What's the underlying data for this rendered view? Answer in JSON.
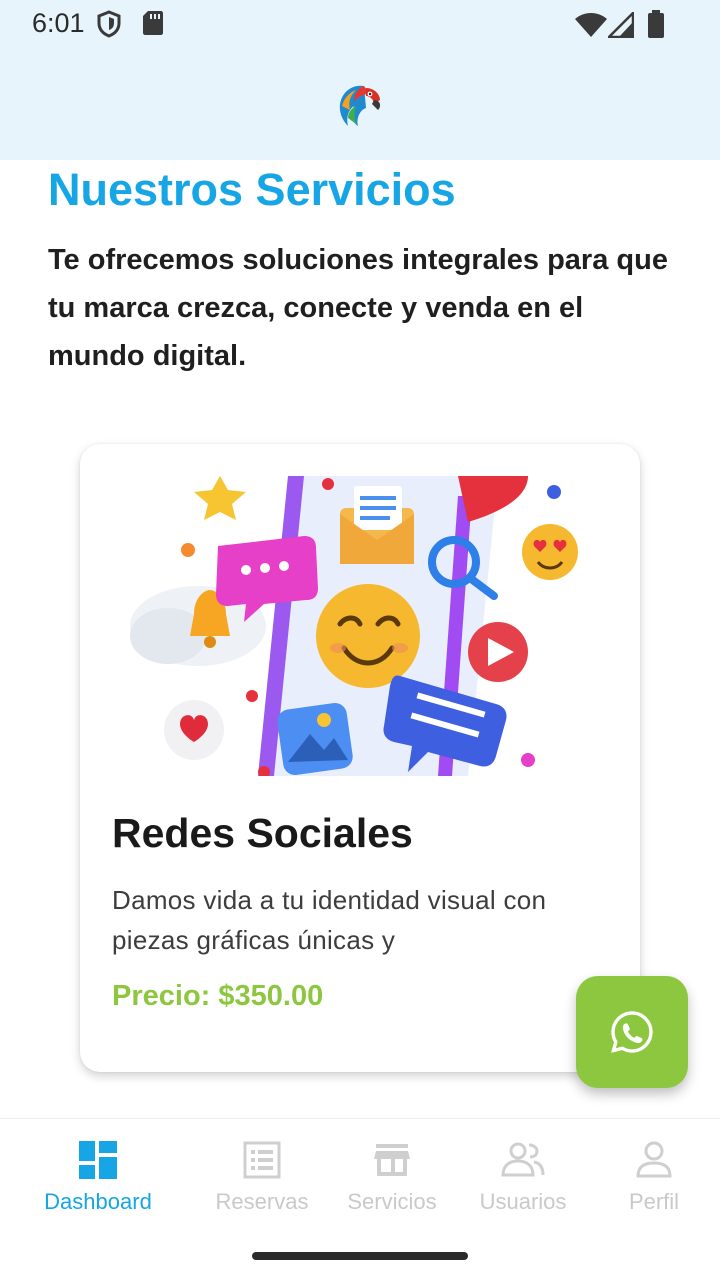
{
  "status_bar": {
    "time": "6:01"
  },
  "header": {
    "logo_icon": "parrot-logo-icon"
  },
  "main": {
    "heading": "Nuestros Servicios",
    "intro": "Te ofrecemos soluciones integrales para que tu marca crezca, conecte y venda en el mundo digital."
  },
  "card": {
    "title": "Redes Sociales",
    "description": "Damos vida a tu identidad visual con piezas gráficas únicas y",
    "price": "Precio: $350.00"
  },
  "fab": {
    "icon": "whatsapp-icon"
  },
  "bottom_nav": {
    "items": [
      {
        "label": "Dashboard",
        "icon": "dashboard-icon",
        "active": true
      },
      {
        "label": "Reservas",
        "icon": "list-icon",
        "active": false
      },
      {
        "label": "Servicios",
        "icon": "store-icon",
        "active": false
      },
      {
        "label": "Usuarios",
        "icon": "users-icon",
        "active": false
      },
      {
        "label": "Perfil",
        "icon": "person-icon",
        "active": false
      }
    ]
  },
  "colors": {
    "accent": "#16a6e6",
    "price": "#8dc63f",
    "header_bg": "#e7f4fc"
  }
}
